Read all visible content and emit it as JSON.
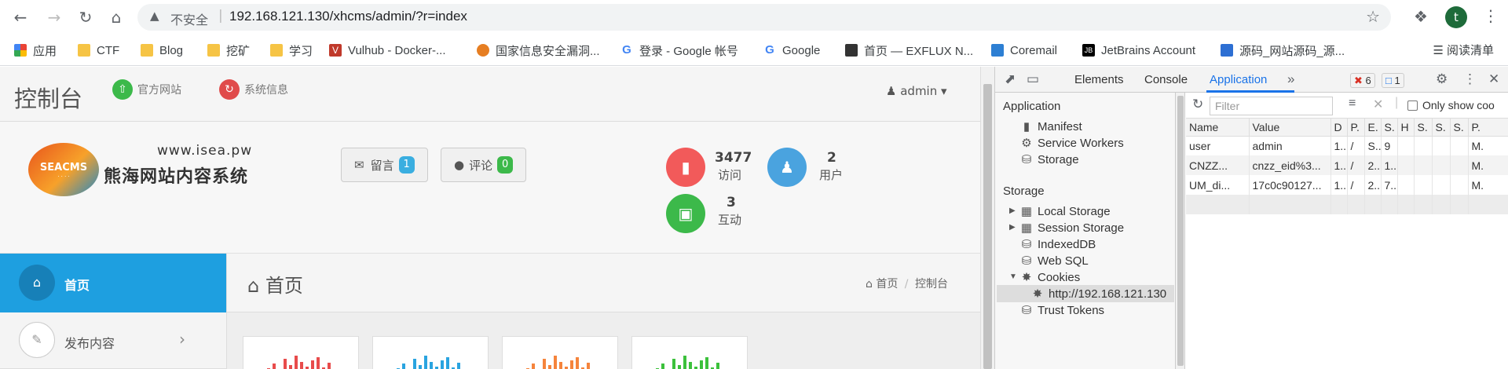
{
  "browser": {
    "insecure_label": "不安全",
    "url": "192.168.121.130/xhcms/admin/?r=index",
    "avatar_letter": "t",
    "bookmarks": [
      {
        "label": "应用",
        "icon": "apps-grid-icon"
      },
      {
        "label": "CTF",
        "icon": "folder-icon"
      },
      {
        "label": "Blog",
        "icon": "folder-icon"
      },
      {
        "label": "挖矿",
        "icon": "folder-icon"
      },
      {
        "label": "学习",
        "icon": "folder-icon"
      },
      {
        "label": "Vulhub - Docker-...",
        "icon": "vulhub-icon"
      },
      {
        "label": "国家信息安全漏洞...",
        "icon": "cnnvd-icon"
      },
      {
        "label": "登录 - Google 帐号",
        "icon": "google-icon"
      },
      {
        "label": "Google",
        "icon": "google-icon"
      },
      {
        "label": "首页 — EXFLUX N...",
        "icon": "exflux-icon"
      },
      {
        "label": "Coremail",
        "icon": "coremail-icon"
      },
      {
        "label": "JetBrains Account",
        "icon": "jetbrains-icon"
      },
      {
        "label": "源码_网站源码_源...",
        "icon": "source-icon"
      }
    ],
    "reading_list": "阅读清单"
  },
  "app": {
    "brand": "控制台",
    "official_site": "官方网站",
    "system_info": "系统信息",
    "user": "admin",
    "logo_badge": "SEACMS",
    "logo_url": "www.isea.pw",
    "logo_name": "熊海网站内容系统",
    "message_label": "留言",
    "message_count": "1",
    "comment_label": "评论",
    "comment_count": "0",
    "stats": [
      {
        "value": "3477",
        "label": "访问",
        "color": "#f25a5a"
      },
      {
        "value": "2",
        "label": "用户",
        "color": "#4aa3df"
      },
      {
        "value": "3",
        "label": "互动",
        "color": "#3cb94a"
      }
    ],
    "nav": [
      {
        "label": "首页"
      },
      {
        "label": "发布内容"
      }
    ],
    "page_title": "首页",
    "breadcrumb_home": "首页",
    "breadcrumb_sep": "/",
    "breadcrumb_current": "控制台",
    "chart_colors": [
      "#e84c4c",
      "#2aa4e0",
      "#f5843c",
      "#3cc13c"
    ]
  },
  "devtools": {
    "tabs": [
      "Elements",
      "Console",
      "Application"
    ],
    "active_tab": "Application",
    "error_count": "6",
    "message_count": "1",
    "sidebar": {
      "application_header": "Application",
      "application_items": [
        "Manifest",
        "Service Workers",
        "Storage"
      ],
      "storage_header": "Storage",
      "storage_items": [
        "Local Storage",
        "Session Storage",
        "IndexedDB",
        "Web SQL",
        "Cookies"
      ],
      "cookie_origin": "http://192.168.121.130",
      "trust_tokens": "Trust Tokens"
    },
    "filter_placeholder": "Filter",
    "only_show": "Only show coo",
    "columns": [
      "Name",
      "Value",
      "D",
      "P.",
      "E.",
      "S.",
      "H",
      "S.",
      "S.",
      "S.",
      "P."
    ],
    "rows": [
      [
        "user",
        "admin",
        "1..",
        "/",
        "S..",
        "9",
        "",
        "",
        "",
        "",
        "M."
      ],
      [
        "CNZZ...",
        "cnzz_eid%3...",
        "1..",
        "/",
        "2..",
        "1...",
        "",
        "",
        "",
        "",
        "M."
      ],
      [
        "UM_di...",
        "17c0c90127...",
        "1..",
        "/",
        "2..",
        "7...",
        "",
        "",
        "",
        "",
        "M."
      ]
    ]
  }
}
